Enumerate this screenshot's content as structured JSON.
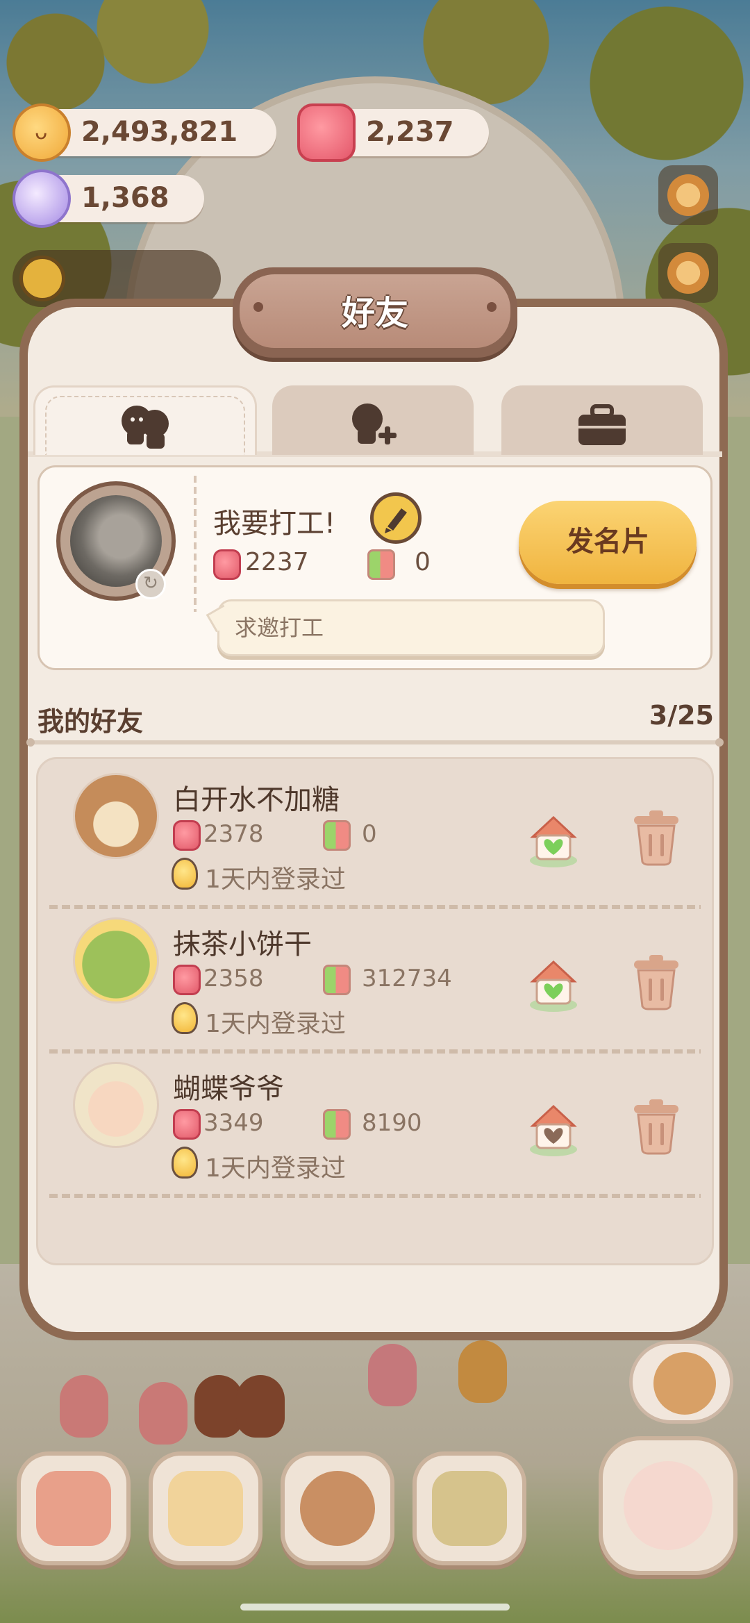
{
  "currency": {
    "coins": "2,493,821",
    "candy": "2,237",
    "gems": "1,368"
  },
  "dialog": {
    "title": "好友",
    "tabs": [
      {
        "icon": "friends-icon",
        "active": true
      },
      {
        "icon": "add-friend-icon",
        "active": false
      },
      {
        "icon": "briefcase-icon",
        "active": false
      }
    ]
  },
  "profile": {
    "name": "我要打工!",
    "candy": "2237",
    "likes": "0",
    "card_button": "发名片",
    "message": "求邀打工"
  },
  "friends_section": {
    "title": "我的好友",
    "count": "3/25"
  },
  "friends": [
    {
      "name": "白开水不加糖",
      "candy": "2378",
      "likes": "0",
      "login": "1天内登录过",
      "visited": true
    },
    {
      "name": "抹茶小饼干",
      "candy": "2358",
      "likes": "312734",
      "login": "1天内登录过",
      "visited": true
    },
    {
      "name": "蝴蝶爷爷",
      "candy": "3349",
      "likes": "8190",
      "login": "1天内登录过",
      "visited": false
    }
  ],
  "colors": {
    "panel": "#f3ebe2",
    "frame": "#8e6a52",
    "accent_button": "#f6c456",
    "heart_green": "#7ccf5a"
  }
}
